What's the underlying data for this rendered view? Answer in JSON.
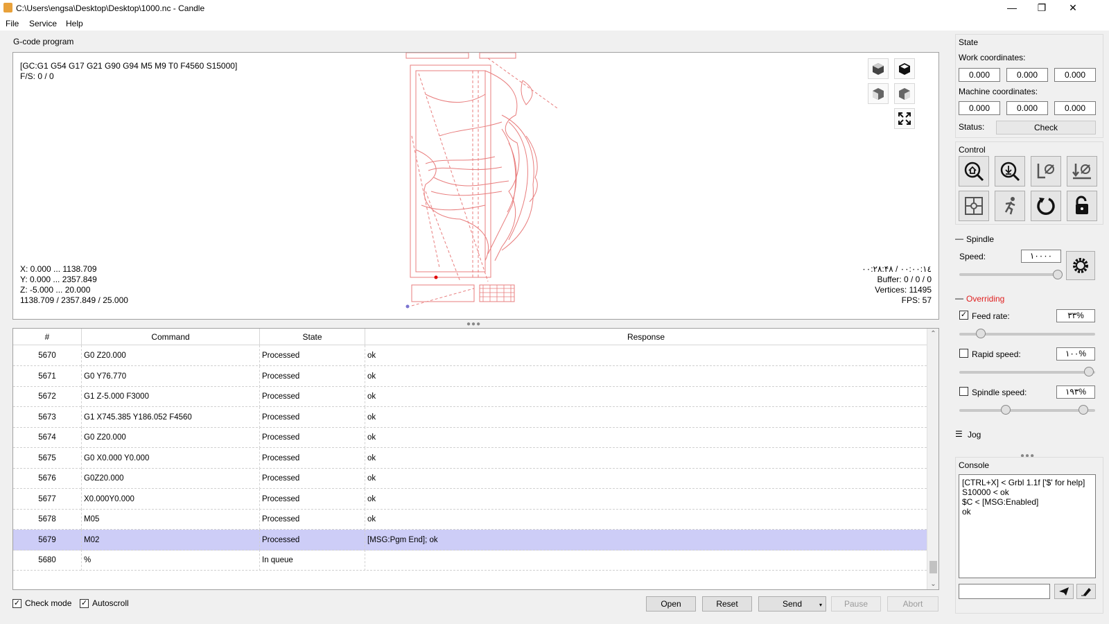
{
  "window": {
    "title": "C:\\Users\\engsa\\Desktop\\Desktop\\1000.nc - Candle",
    "minimize": "—",
    "maximize": "❐",
    "close": "✕"
  },
  "menu": [
    "File",
    "Service",
    "Help"
  ],
  "gcode_program": {
    "label": "G-code program",
    "gc_line": "[GC:G1 G54 G17 G21 G90 G94 M5 M9 T0 F4560 S15000]",
    "fs_line": "F/S: 0 / 0",
    "bounds": {
      "x": "X: 0.000 ... 1138.709",
      "y": "Y: 0.000 ... 2357.849",
      "z": "Z: -5.000 ... 20.000",
      "size": "1138.709 / 2357.849 / 25.000"
    },
    "stats": {
      "time": "۰۰:۲۸:۴۸ / ۰۰:۰۰:۱٤",
      "buffer": "Buffer: 0 / 0 / 0",
      "vertices": "Vertices: 11495",
      "fps": "FPS: 57"
    },
    "toolpath_color": "#e87c7c"
  },
  "table": {
    "headers": [
      "#",
      "Command",
      "State",
      "Response"
    ],
    "rows": [
      {
        "num": "5670",
        "command": "G0  Z20.000",
        "state": "Processed",
        "response": "ok"
      },
      {
        "num": "5671",
        "command": "G0  Y76.770",
        "state": "Processed",
        "response": "ok"
      },
      {
        "num": "5672",
        "command": "G1  Z-5.000 F3000",
        "state": "Processed",
        "response": "ok"
      },
      {
        "num": "5673",
        "command": "G1 X745.385 Y186.052  F4560",
        "state": "Processed",
        "response": "ok"
      },
      {
        "num": "5674",
        "command": "G0  Z20.000",
        "state": "Processed",
        "response": "ok"
      },
      {
        "num": "5675",
        "command": "G0 X0.000 Y0.000",
        "state": "Processed",
        "response": "ok"
      },
      {
        "num": "5676",
        "command": "G0Z20.000",
        "state": "Processed",
        "response": "ok"
      },
      {
        "num": "5677",
        "command": "X0.000Y0.000",
        "state": "Processed",
        "response": "ok"
      },
      {
        "num": "5678",
        "command": "M05",
        "state": "Processed",
        "response": "ok"
      },
      {
        "num": "5679",
        "command": "M02",
        "state": "Processed",
        "response": "[MSG:Pgm End]; ok"
      },
      {
        "num": "5680",
        "command": "%",
        "state": "In queue",
        "response": ""
      }
    ],
    "selected_row": "5679"
  },
  "bottom": {
    "check_mode": "Check mode",
    "autoscroll": "Autoscroll",
    "open": "Open",
    "reset": "Reset",
    "send": "Send",
    "pause": "Pause",
    "abort": "Abort"
  },
  "state": {
    "label": "State",
    "work_label": "Work coordinates:",
    "work": [
      "0.000",
      "0.000",
      "0.000"
    ],
    "machine_label": "Machine coordinates:",
    "machine": [
      "0.000",
      "0.000",
      "0.000"
    ],
    "status_label": "Status:",
    "status": "Check"
  },
  "control": {
    "label": "Control",
    "buttons": [
      "home-icon",
      "probe-icon",
      "zero-xy-icon",
      "zero-z-icon",
      "restore-origin-icon",
      "safe-position-icon",
      "soft-reset-icon",
      "unlock-icon"
    ]
  },
  "spindle": {
    "label": "Spindle",
    "speed_label": "Speed:",
    "speed": "۱۰۰۰۰",
    "slider_level": 0.97
  },
  "overriding": {
    "label": "Overriding",
    "label_color": "#e02020",
    "feed_label": "Feed rate:",
    "feed_value": "۳۳%",
    "feed_checked": true,
    "rapid_label": "Rapid speed:",
    "rapid_value": "۱۰۰%",
    "rapid_checked": false,
    "spindle_label": "Spindle speed:",
    "spindle_value": "۱۹۳%",
    "spindle_checked": false
  },
  "jog": {
    "label": "Jog"
  },
  "console": {
    "label": "Console",
    "text": "[CTRL+X] < Grbl 1.1f ['$' for help]\nS10000 < ok\n$C < [MSG:Enabled]\nok",
    "input_placeholder": ""
  }
}
